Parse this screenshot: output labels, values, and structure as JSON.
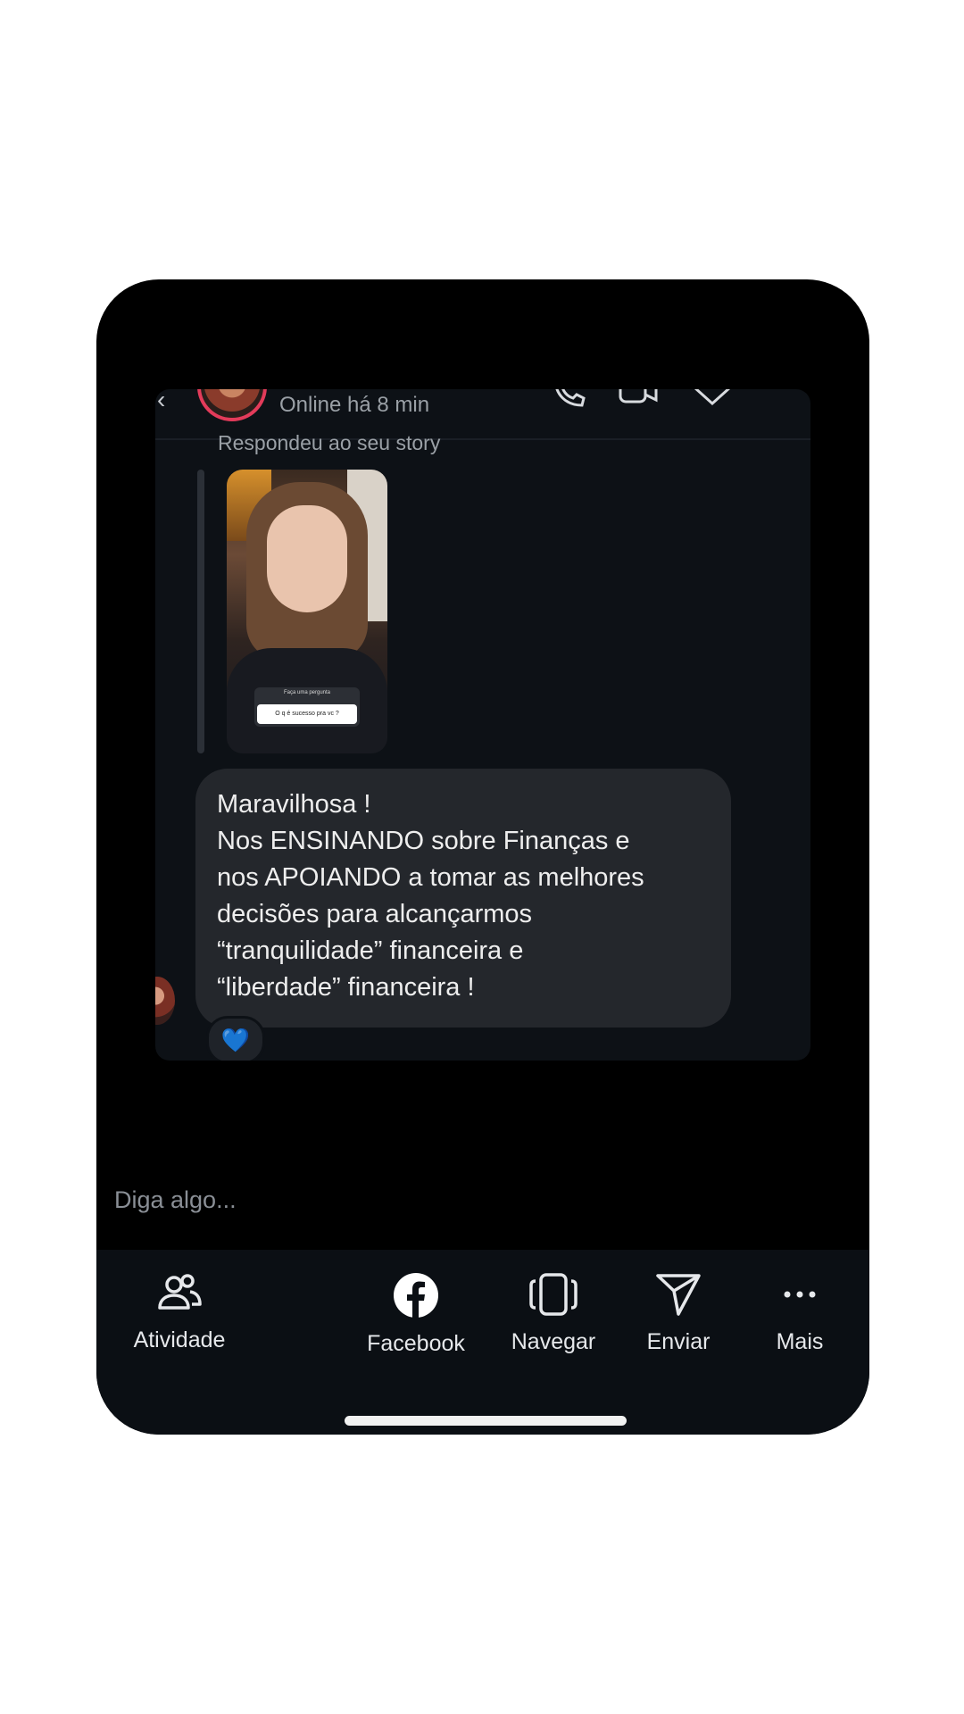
{
  "header": {
    "status": "Online há 8 min",
    "replied_label": "Respondeu ao seu story"
  },
  "story": {
    "question_title": "Faça uma pergunta",
    "question_text": "O q é sucesso pra vc ?"
  },
  "message": {
    "title": "Maravilhosa !",
    "body": "Nos ENSINANDO sobre Finanças e\nnos APOIANDO a tomar as melhores\ndecisões para alcançarmos\n“tranquilidade” financeira e\n“liberdade” financeira !",
    "reaction": "💙"
  },
  "composer": {
    "placeholder": "Diga algo..."
  },
  "toolbar": {
    "items": [
      {
        "label": "Atividade",
        "icon": "people-icon"
      },
      {
        "label": "Facebook",
        "icon": "facebook-icon"
      },
      {
        "label": "Navegar",
        "icon": "browse-icon"
      },
      {
        "label": "Enviar",
        "icon": "send-icon"
      },
      {
        "label": "Mais",
        "icon": "more-icon"
      }
    ]
  },
  "colors": {
    "background": "#000000",
    "panel": "#0d1116",
    "bubble": "#24272c",
    "avatar_ring": "#e33b5a",
    "text": "#eeeeee",
    "muted": "#9aa0a6"
  }
}
